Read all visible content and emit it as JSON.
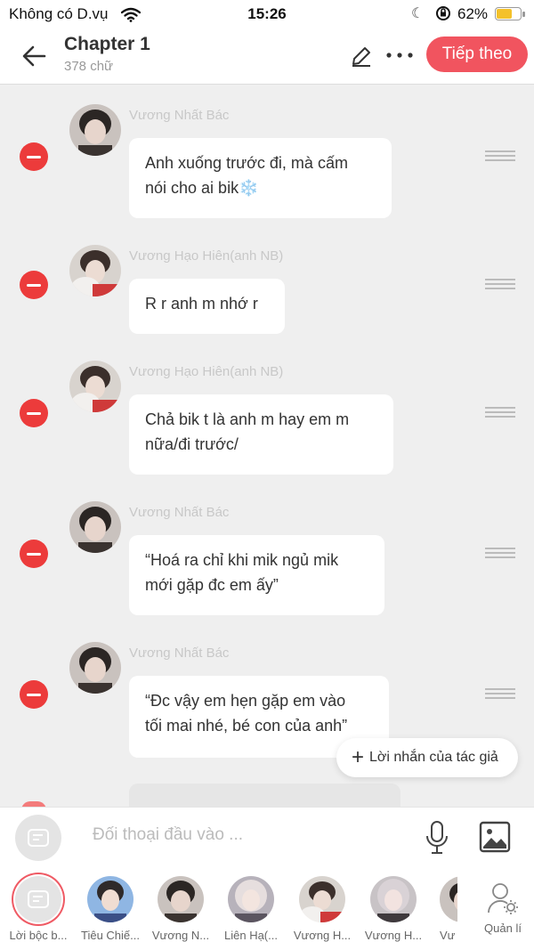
{
  "status_bar": {
    "carrier": "Không có D.vụ",
    "time": "15:26",
    "battery": "62%",
    "battery_level": 0.62
  },
  "header": {
    "title": "Chapter 1",
    "word_count": "378 chữ",
    "next_label": "Tiếp theo"
  },
  "messages": [
    {
      "sender": "Vương Nhất Bác",
      "text": "Anh xuống trước đi, mà cấm\nnói cho ai bik❄️"
    },
    {
      "sender": "Vương Hạo Hiên(anh NB)",
      "text": "R r anh m nhớ r"
    },
    {
      "sender": "Vương Hạo Hiên(anh NB)",
      "text": "Chả bik t là anh m hay em m\nnữa/đi trước/"
    },
    {
      "sender": "Vương Nhất Bác",
      "text": "“Hoá ra chỉ khi mik ngủ mik\nmới gặp đc em ấy”"
    },
    {
      "sender": "Vương Nhất Bác",
      "text": "“Đc vậy em hẹn gặp em vào\ntối mai nhé, bé con của anh”"
    }
  ],
  "author_note_label": "Lời nhắn của tác giả",
  "input": {
    "placeholder": "Đối thoại đầu vào ..."
  },
  "characters": [
    {
      "name": "Lời bộc b..."
    },
    {
      "name": "Tiêu Chiế..."
    },
    {
      "name": "Vương N..."
    },
    {
      "name": "Liên Hạ(..."
    },
    {
      "name": "Vương H..."
    },
    {
      "name": "Vương H..."
    },
    {
      "name": "Vư"
    }
  ],
  "manage_label": "Quản lí",
  "colors": {
    "accent": "#f1545f",
    "remove": "#ec3b3b",
    "background": "#efefef"
  }
}
